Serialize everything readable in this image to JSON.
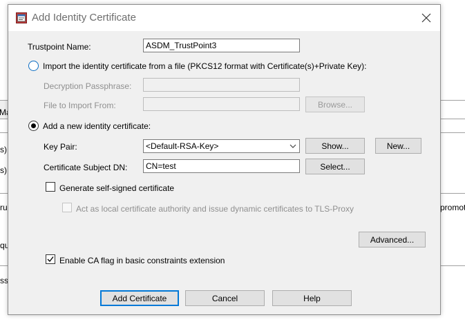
{
  "background": {
    "fragments": [
      "Ma",
      "s)",
      "s)",
      "ru",
      "promot",
      "qu",
      "ssi"
    ]
  },
  "dialog": {
    "title": "Add Identity Certificate",
    "trustpoint": {
      "label": "Trustpoint Name:",
      "value": "ASDM_TrustPoint3"
    },
    "import_option": {
      "label": "Import the identity certificate from a file (PKCS12 format with Certificate(s)+Private Key):",
      "selected": false,
      "passphrase_label": "Decryption Passphrase:",
      "passphrase_value": "",
      "file_label": "File to Import From:",
      "file_value": "",
      "browse_label": "Browse..."
    },
    "new_option": {
      "label": "Add a new identity certificate:",
      "selected": true,
      "key_pair_label": "Key Pair:",
      "key_pair_value": "<Default-RSA-Key>",
      "show_label": "Show...",
      "new_label": "New...",
      "subject_dn_label": "Certificate Subject DN:",
      "subject_dn_value": "CN=test",
      "select_label": "Select...",
      "self_signed_label": "Generate self-signed certificate",
      "self_signed_checked": false,
      "local_ca_label": "Act as local certificate authority and issue dynamic certificates to TLS-Proxy",
      "local_ca_checked": false,
      "advanced_label": "Advanced..."
    },
    "ca_flag": {
      "label": "Enable CA flag in basic constraints extension",
      "checked": true
    },
    "buttons": {
      "add": "Add Certificate",
      "cancel": "Cancel",
      "help": "Help"
    }
  }
}
